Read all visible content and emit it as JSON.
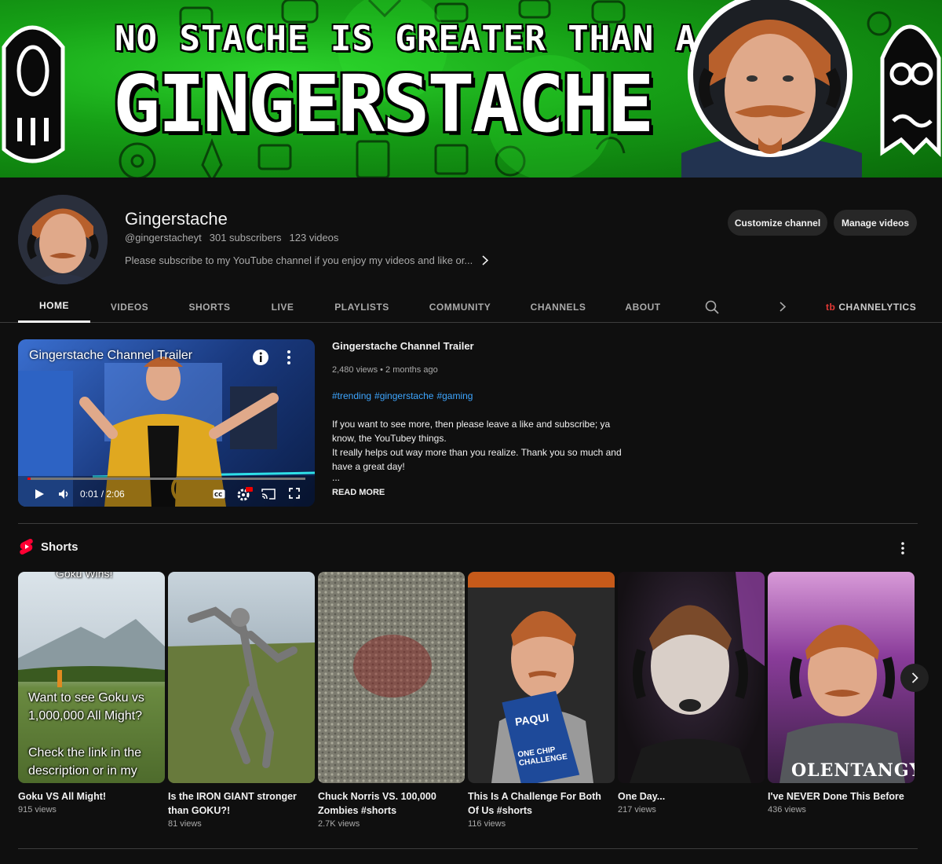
{
  "banner": {
    "line1": "NO STACHE IS GREATER THAN A",
    "line2": "GINGERSTACHE"
  },
  "channel": {
    "name": "Gingerstache",
    "handle": "@gingerstacheyt",
    "subscribers": "301 subscribers",
    "videos": "123 videos",
    "description": "Please subscribe to my YouTube channel if you enjoy my videos and like or...",
    "customize_label": "Customize channel",
    "manage_label": "Manage videos"
  },
  "tabs": {
    "home": "HOME",
    "videos": "VIDEOS",
    "shorts": "SHORTS",
    "live": "LIVE",
    "playlists": "PLAYLISTS",
    "community": "COMMUNITY",
    "channels": "CHANNELS",
    "about": "ABOUT",
    "channelytics": "CHANNELYTICS",
    "channelytics_logo": "tb"
  },
  "trailer": {
    "player_title": "Gingerstache Channel Trailer",
    "time": "0:01 / 2:06",
    "progress": 0.01,
    "title": "Gingerstache Channel Trailer",
    "meta": "2,480 views • 2 months ago",
    "tags": [
      "#trending",
      "#gingerstache",
      "#gaming"
    ],
    "desc1": "If you want to see more, then please leave a like and subscribe; ya know, the YouTubey things.",
    "desc2": "It really helps out way more than you realize. Thank you so much and have a great day!",
    "ellipsis": "...",
    "read_more": "READ MORE"
  },
  "shorts": {
    "heading": "Shorts",
    "items": [
      {
        "title": "Goku VS All Might!",
        "views": "915 views",
        "caption1": "Want to see Goku vs 1,000,000 All Might?",
        "caption2": "Check the link in the description or in my",
        "top_caption": "Goku Wins!"
      },
      {
        "title": "Is the IRON GIANT stronger than GOKU?!",
        "views": "81 views"
      },
      {
        "title": "Chuck Norris VS. 100,000 Zombies #shorts",
        "views": "2.7K views"
      },
      {
        "title": "This Is A Challenge For Both Of Us #shorts",
        "views": "116 views",
        "chip_brand": "PAQUI",
        "chip_text": "ONE CHIP CHALLENGE"
      },
      {
        "title": "One Day...",
        "views": "217 views"
      },
      {
        "title": "I've NEVER Done This Before",
        "views": "436 views",
        "shirt_text": "OLENTANGY"
      }
    ]
  },
  "colors": {
    "background": "#0f0f0f",
    "accent_link": "#3ea6ff",
    "shorts_red": "#ff0033",
    "banner_green": "#16a016"
  }
}
